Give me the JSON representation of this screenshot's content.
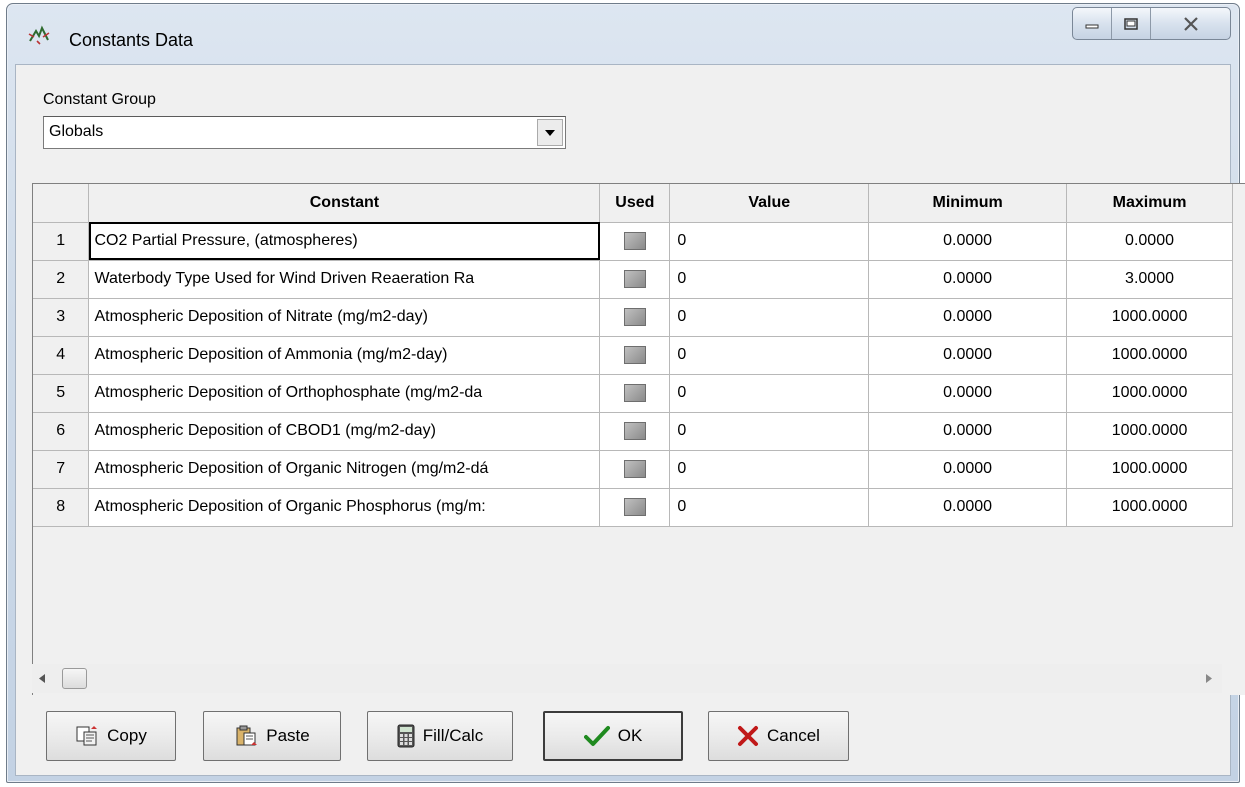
{
  "window": {
    "title": "Constants Data"
  },
  "constant_group": {
    "label": "Constant Group",
    "selected": "Globals"
  },
  "table": {
    "headers": {
      "row": "",
      "constant": "Constant",
      "used": "Used",
      "value": "Value",
      "minimum": "Minimum",
      "maximum": "Maximum"
    },
    "rows": [
      {
        "num": "1",
        "constant": "CO2 Partial Pressure, (atmospheres)",
        "value": "0",
        "minimum": "0.0000",
        "maximum": "0.0000"
      },
      {
        "num": "2",
        "constant": "Waterbody Type Used for Wind Driven Reaeration Ra",
        "value": "0",
        "minimum": "0.0000",
        "maximum": "3.0000"
      },
      {
        "num": "3",
        "constant": "Atmospheric Deposition of Nitrate (mg/m2-day)",
        "value": "0",
        "minimum": "0.0000",
        "maximum": "1000.0000"
      },
      {
        "num": "4",
        "constant": "Atmospheric Deposition of Ammonia (mg/m2-day)",
        "value": "0",
        "minimum": "0.0000",
        "maximum": "1000.0000"
      },
      {
        "num": "5",
        "constant": "Atmospheric Deposition of Orthophosphate (mg/m2-da",
        "value": "0",
        "minimum": "0.0000",
        "maximum": "1000.0000"
      },
      {
        "num": "6",
        "constant": "Atmospheric Deposition of CBOD1 (mg/m2-day)",
        "value": "0",
        "minimum": "0.0000",
        "maximum": "1000.0000"
      },
      {
        "num": "7",
        "constant": "Atmospheric Deposition of Organic Nitrogen (mg/m2-dá",
        "value": "0",
        "minimum": "0.0000",
        "maximum": "1000.0000"
      },
      {
        "num": "8",
        "constant": "Atmospheric Deposition of Organic Phosphorus (mg/m:",
        "value": "0",
        "minimum": "0.0000",
        "maximum": "1000.0000"
      }
    ]
  },
  "buttons": {
    "copy": "Copy",
    "paste": "Paste",
    "fill_calc": "Fill/Calc",
    "ok": "OK",
    "cancel": "Cancel"
  }
}
